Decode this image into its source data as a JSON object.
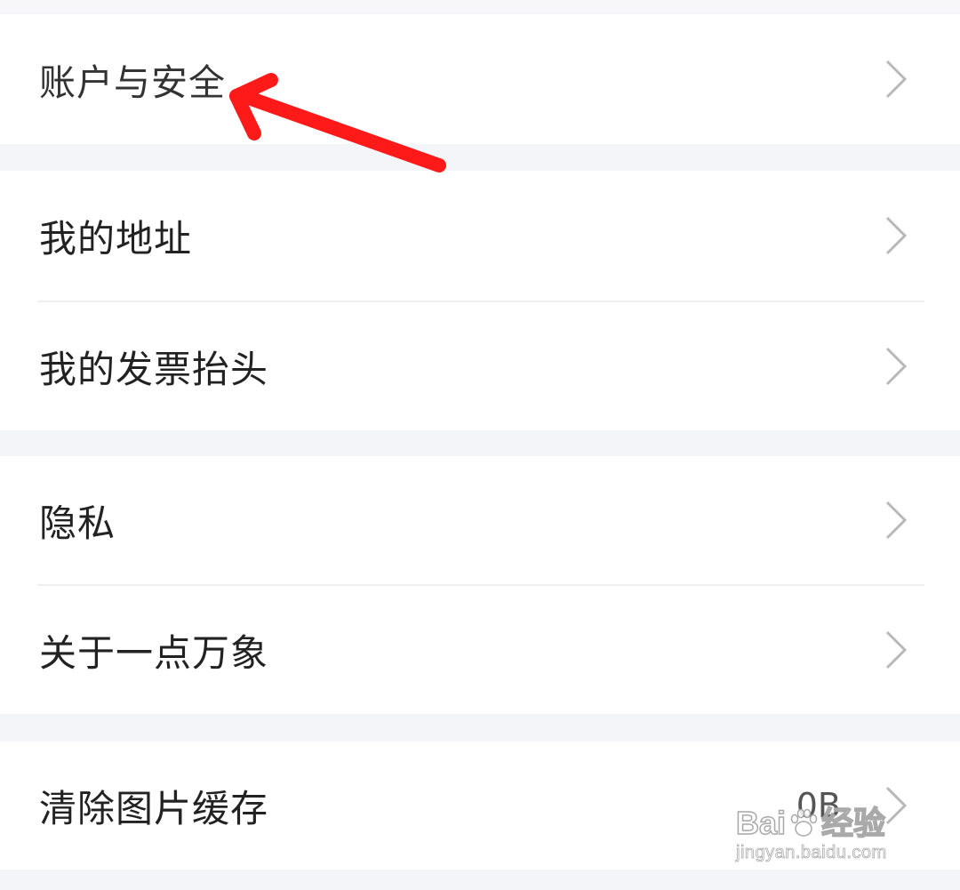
{
  "settings": {
    "items": [
      {
        "label": "账户与安全"
      },
      {
        "label": "我的地址"
      },
      {
        "label": "我的发票抬头"
      },
      {
        "label": "隐私"
      },
      {
        "label": "关于一点万象"
      },
      {
        "label": "清除图片缓存",
        "value": "0B"
      }
    ]
  },
  "icons": {
    "chevron": "chevron-right-icon",
    "arrow": "red-annotation-arrow-icon"
  },
  "watermark": {
    "brand_left": "Bai",
    "brand_right": "经验",
    "url": "jingyan.baidu.com"
  },
  "colors": {
    "background": "#f4f5f8",
    "row_background": "#ffffff",
    "text": "#222222",
    "chevron": "#bbbbbb",
    "annotation_arrow": "#ff1a1a"
  }
}
